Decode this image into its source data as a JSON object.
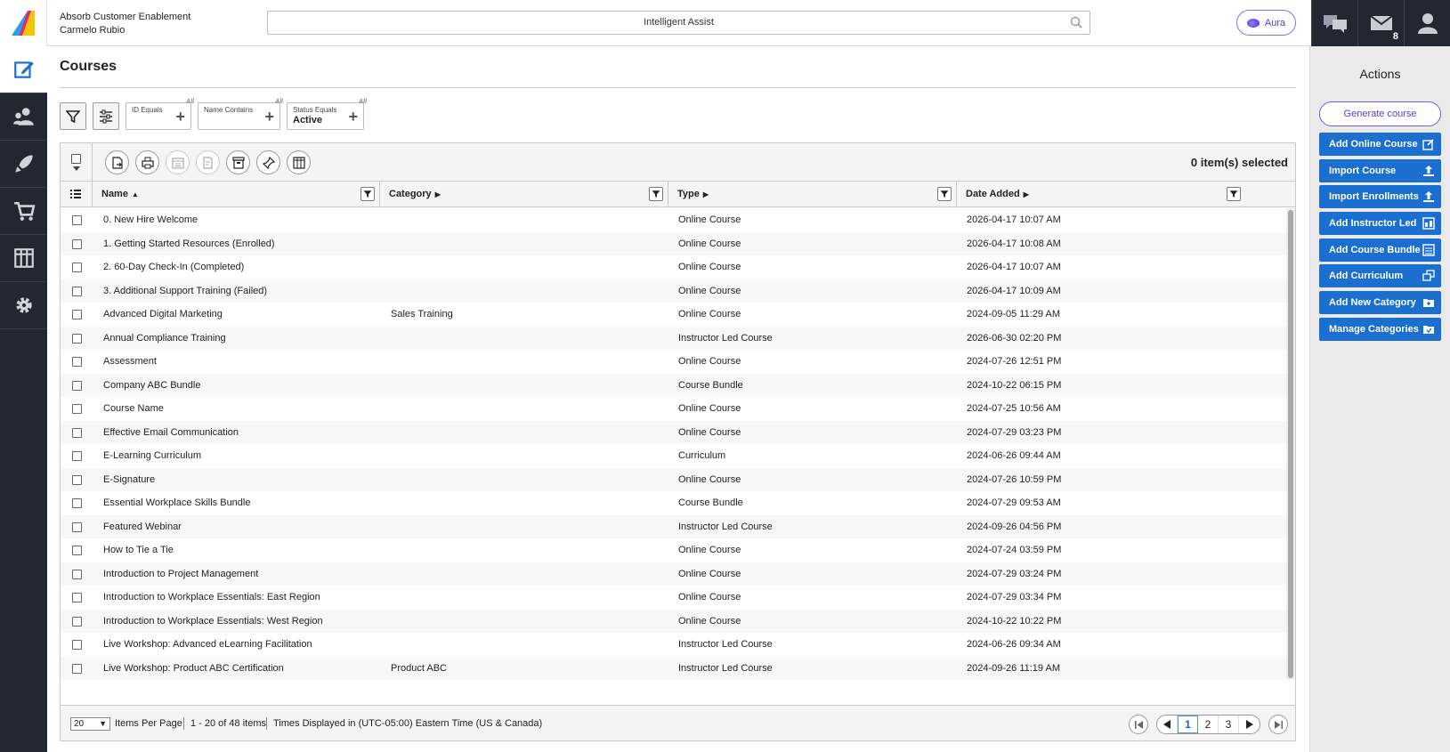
{
  "header": {
    "org_name": "Absorb Customer Enablement",
    "user_name": "Carmelo Rubio",
    "search_placeholder": "Intelligent Assist",
    "aura_label": "Aura",
    "messages_count": "8"
  },
  "page": {
    "title": "Courses"
  },
  "filters": [
    {
      "key": "ID Equals",
      "value": ""
    },
    {
      "key": "Name Contains",
      "value": ""
    },
    {
      "key": "Status Equals",
      "value": "Active"
    }
  ],
  "grid": {
    "selected_count": "0 item(s) selected",
    "columns": {
      "name": "Name",
      "category": "Category",
      "type": "Type",
      "date": "Date Added"
    },
    "rows": [
      {
        "name": "0. New Hire Welcome",
        "category": "",
        "type": "Online Course",
        "date": "2026-04-17 10:07 AM"
      },
      {
        "name": "1. Getting Started Resources (Enrolled)",
        "category": "",
        "type": "Online Course",
        "date": "2026-04-17 10:08 AM"
      },
      {
        "name": "2. 60-Day Check-In (Completed)",
        "category": "",
        "type": "Online Course",
        "date": "2026-04-17 10:07 AM"
      },
      {
        "name": "3. Additional Support Training (Failed)",
        "category": "",
        "type": "Online Course",
        "date": "2026-04-17 10:09 AM"
      },
      {
        "name": "Advanced Digital Marketing",
        "category": "Sales Training",
        "type": "Online Course",
        "date": "2024-09-05 11:29 AM"
      },
      {
        "name": "Annual Compliance Training",
        "category": "",
        "type": "Instructor Led Course",
        "date": "2026-06-30 02:20 PM"
      },
      {
        "name": "Assessment",
        "category": "",
        "type": "Online Course",
        "date": "2024-07-26 12:51 PM"
      },
      {
        "name": "Company ABC Bundle",
        "category": "",
        "type": "Course Bundle",
        "date": "2024-10-22 06:15 PM"
      },
      {
        "name": "Course Name",
        "category": "",
        "type": "Online Course",
        "date": "2024-07-25 10:56 AM"
      },
      {
        "name": "Effective Email Communication",
        "category": "",
        "type": "Online Course",
        "date": "2024-07-29 03:23 PM"
      },
      {
        "name": "E-Learning Curriculum",
        "category": "",
        "type": "Curriculum",
        "date": "2024-06-26 09:44 AM"
      },
      {
        "name": "E-Signature",
        "category": "",
        "type": "Online Course",
        "date": "2024-07-26 10:59 PM"
      },
      {
        "name": "Essential Workplace Skills Bundle",
        "category": "",
        "type": "Course Bundle",
        "date": "2024-07-29 09:53 AM"
      },
      {
        "name": "Featured Webinar",
        "category": "",
        "type": "Instructor Led Course",
        "date": "2024-09-26 04:56 PM"
      },
      {
        "name": "How to Tie a Tie",
        "category": "",
        "type": "Online Course",
        "date": "2024-07-24 03:59 PM"
      },
      {
        "name": "Introduction to Project Management",
        "category": "",
        "type": "Online Course",
        "date": "2024-07-29 03:24 PM"
      },
      {
        "name": "Introduction to Workplace Essentials: East Region",
        "category": "",
        "type": "Online Course",
        "date": "2024-07-29 03:34 PM"
      },
      {
        "name": "Introduction to Workplace Essentials: West Region",
        "category": "",
        "type": "Online Course",
        "date": "2024-10-22 10:22 PM"
      },
      {
        "name": "Live Workshop: Advanced eLearning Facilitation",
        "category": "",
        "type": "Instructor Led Course",
        "date": "2024-06-26 09:34 AM"
      },
      {
        "name": "Live Workshop: Product ABC Certification",
        "category": "Product ABC",
        "type": "Instructor Led Course",
        "date": "2024-09-26 11:19 AM"
      }
    ]
  },
  "footer": {
    "per_page_value": "20",
    "per_page_label": "Items Per Page",
    "range": "1 - 20 of 48 items",
    "timezone": "Times Displayed in (UTC-05:00) Eastern Time (US & Canada)",
    "pages": [
      "1",
      "2",
      "3"
    ],
    "current_page": "1"
  },
  "actions": {
    "title": "Actions",
    "generate": "Generate course",
    "buttons": [
      "Add Online Course",
      "Import Course",
      "Import Enrollments",
      "Add Instructor Led",
      "Add Course Bundle",
      "Add Curriculum",
      "Add New Category",
      "Manage Categories"
    ]
  },
  "colors": {
    "accent": "#1a6fd1",
    "nav_bg": "#232732",
    "aura": "#5a3ccf"
  }
}
